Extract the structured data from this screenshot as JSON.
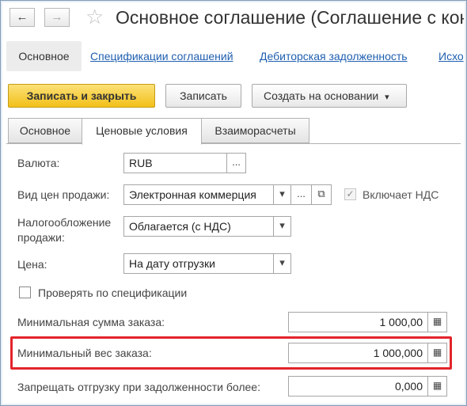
{
  "window": {
    "title": "Основное соглашение (Соглашение с конт",
    "back_icon": "←",
    "forward_icon": "→",
    "favorite_icon": "☆"
  },
  "sections": {
    "active": "Основное",
    "links": [
      "Спецификации соглашений",
      "Дебиторская задолженность",
      "Исхо"
    ]
  },
  "toolbar": {
    "save_close": "Записать и закрыть",
    "save": "Записать",
    "create_based": "Создать на основании",
    "dropdown_arrow": "▾"
  },
  "tabs": [
    "Основное",
    "Ценовые условия",
    "Взаиморасчеты"
  ],
  "form": {
    "currency_label": "Валюта:",
    "currency_value": "RUB",
    "price_type_label": "Вид цен продажи:",
    "price_type_value": "Электронная коммерция",
    "vat_included_label": "Включает НДС",
    "vat_included": true,
    "taxation_label": "Налогообложение продажи:",
    "taxation_value": "Облагается (с НДС)",
    "price_label": "Цена:",
    "price_value": "На дату отгрузки",
    "check_spec_label": "Проверять по спецификации",
    "check_spec": false,
    "min_sum_label": "Минимальная сумма заказа:",
    "min_sum_value": "1 000,00",
    "min_weight_label": "Минимальный вес заказа:",
    "min_weight_value": "1 000,000",
    "debt_limit_label": "Запрещать отгрузку при задолженности более:",
    "debt_limit_value": "0,000"
  },
  "glyphs": {
    "ellipsis": "...",
    "open": "⧉",
    "dropdown": "▾",
    "check": "✓",
    "calculator": "▦"
  },
  "colors": {
    "primary_button": "#f2c019",
    "link": "#1f5fb0",
    "highlight_border": "#e3242b"
  }
}
